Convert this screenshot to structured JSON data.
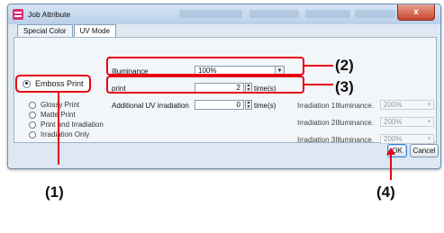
{
  "window": {
    "title": "Job Attribute",
    "close_label": "x"
  },
  "tabs": [
    {
      "label": "Special Color"
    },
    {
      "label": "UV Mode"
    }
  ],
  "modes": {
    "selected": "Emboss Print",
    "items": [
      {
        "label": "Emboss Print"
      },
      {
        "label": "Glossy Print"
      },
      {
        "label": "Matte Print"
      },
      {
        "label": "Print and Irradiation"
      },
      {
        "label": "Irradiation Only"
      }
    ]
  },
  "settings": {
    "illuminance_label": "Illuminance",
    "illuminance_value": "100%",
    "print_label": "print",
    "print_value": "2",
    "print_unit": "time(s)",
    "additional_label": "Additional UV irradiation",
    "additional_value": "0",
    "additional_unit": "time(s)",
    "irradiation": [
      {
        "label": "Irradiation 1Illuminance.",
        "value": "200%"
      },
      {
        "label": "Irradiation 2Illuminance.",
        "value": "200%"
      },
      {
        "label": "Irradiation 3Illuminance.",
        "value": "200%"
      }
    ]
  },
  "buttons": {
    "ok": "OK",
    "cancel": "Cancel"
  },
  "callouts": {
    "c1": "(1)",
    "c2": "(2)",
    "c3": "(3)",
    "c4": "(4)"
  },
  "colors": {
    "highlight": "#e60012"
  }
}
